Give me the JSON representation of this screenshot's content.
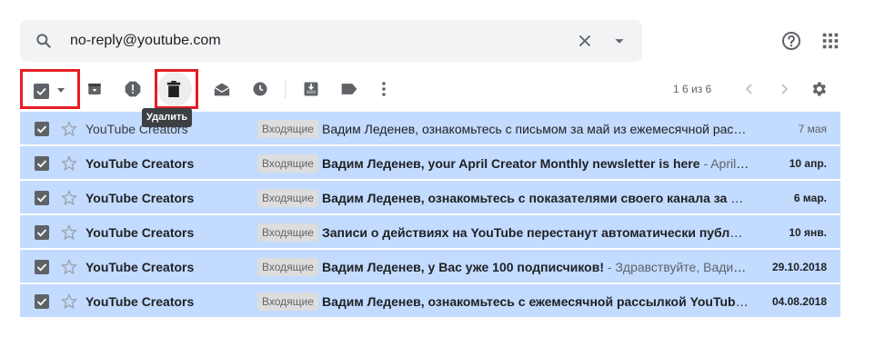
{
  "search": {
    "query": "no-reply@youtube.com"
  },
  "toolbar": {
    "pager": "1 6 из 6",
    "tooltip": "Удалить"
  },
  "emails": [
    {
      "sender": "YouTube Creators",
      "label": "Входящие",
      "subject": "Вадим Леденев, ознакомьтесь с письмом за май из ежемесячной расс...",
      "snippet": "",
      "date": "7 мая",
      "unread": false
    },
    {
      "sender": "YouTube Creators",
      "label": "Входящие",
      "subject": "Вадим Леденев, your April Creator Monthly newsletter is here",
      "snippet": " - April 2019...",
      "date": "10 апр.",
      "unread": true
    },
    {
      "sender": "YouTube Creators",
      "label": "Входящие",
      "subject": "Вадим Леденев, ознакомьтесь с показателями своего канала за посл...",
      "snippet": "",
      "date": "6 мар.",
      "unread": true
    },
    {
      "sender": "YouTube Creators",
      "label": "Входящие",
      "subject": "Записи о действиях на YouTube перестанут автоматически публикова...",
      "snippet": "",
      "date": "10 янв.",
      "unread": true
    },
    {
      "sender": "YouTube Creators",
      "label": "Входящие",
      "subject": "Вадим Леденев, у Вас уже 100 подписчиков!",
      "snippet": " - Здравствуйте, Вадим Л...",
      "date": "29.10.2018",
      "unread": true
    },
    {
      "sender": "YouTube Creators",
      "label": "Входящие",
      "subject": "Вадим Леденев, ознакомьтесь с ежемесячной рассылкой YouTube",
      "snippet": " - ...",
      "date": "04.08.2018",
      "unread": true
    }
  ],
  "colors": {
    "selected_row": "#c2dbff",
    "highlight_box": "#e51c23",
    "icon": "#5f6368"
  },
  "icons": [
    "search-icon",
    "close-icon",
    "caret-down-icon",
    "help-icon",
    "apps-grid-icon",
    "archive-icon",
    "report-spam-icon",
    "trash-icon",
    "mark-read-icon",
    "snooze-icon",
    "move-to-icon",
    "label-icon",
    "more-vert-icon",
    "chevron-left-icon",
    "chevron-right-icon",
    "gear-icon",
    "star-icon",
    "checkbox-checked-icon"
  ]
}
